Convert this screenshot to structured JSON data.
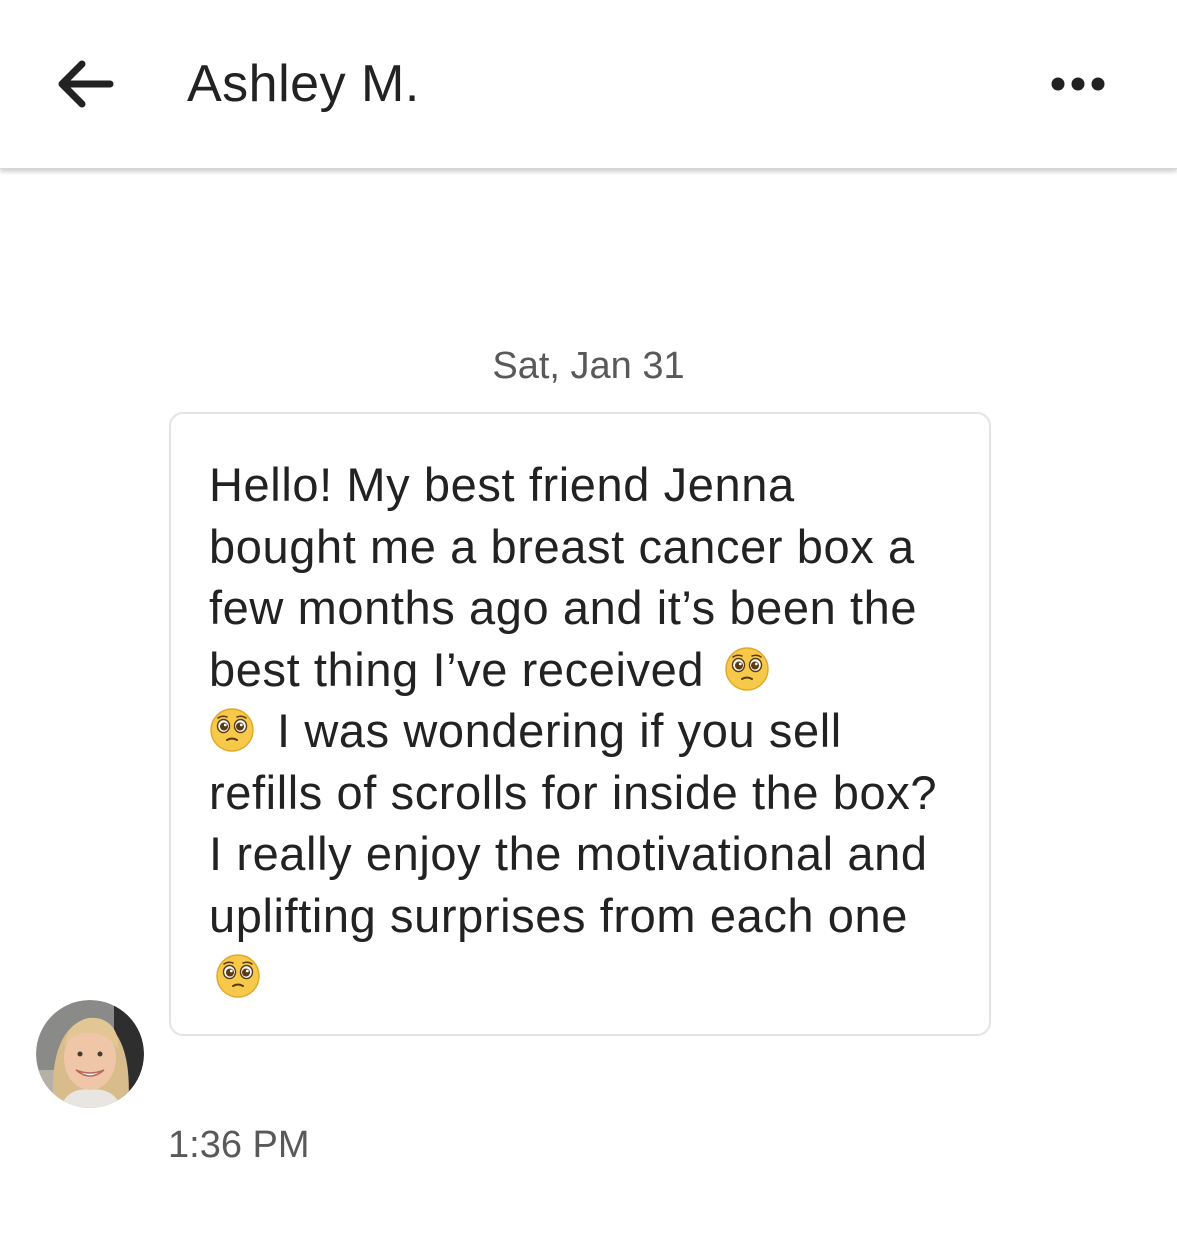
{
  "header": {
    "back_icon": "arrow-left-icon",
    "title": "Ashley M.",
    "more_icon": "more-horizontal-icon"
  },
  "conversation": {
    "date_separator": "Sat, Jan 31",
    "message": {
      "segment_1": "Hello! My best friend Jenna bought me a breast cancer box a few months ago and it’s been the best thing I’ve received",
      "segment_2": "I was wondering if you sell refills of scrolls for inside the box? I really enjoy the motivational and uplifting surprises from each one",
      "emoji": "pleading-face-emoji",
      "time": "1:36 PM"
    },
    "sender_avatar": "sender-avatar-photo"
  },
  "colors": {
    "text_primary": "#222222",
    "text_secondary": "#595959",
    "bubble_border": "#e3e3e3",
    "emoji_face": "#f7c94a"
  }
}
